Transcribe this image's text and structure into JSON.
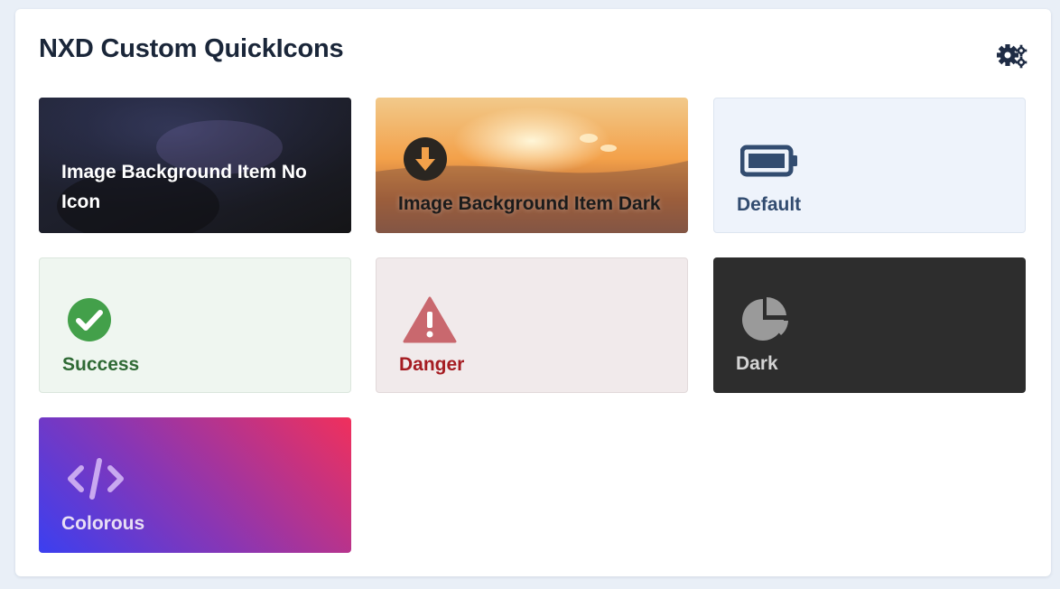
{
  "module": {
    "title": "NXD Custom QuickIcons",
    "settings_icon": "gears-icon"
  },
  "tiles": [
    {
      "label": "Image Background Item No Icon",
      "style": "image-dark",
      "icon": ""
    },
    {
      "label": "Image Background Item Dark",
      "style": "image-sunset",
      "icon": "arrow-down-circle-icon"
    },
    {
      "label": "Default",
      "style": "default",
      "icon": "battery-icon",
      "accent": "#324c70"
    },
    {
      "label": "Success",
      "style": "success",
      "icon": "check-circle-icon",
      "accent": "#43a04a"
    },
    {
      "label": "Danger",
      "style": "danger",
      "icon": "warning-triangle-icon",
      "accent": "#c9686e"
    },
    {
      "label": "Dark",
      "style": "dark",
      "icon": "pie-chart-icon",
      "accent": "#9a9a9a"
    },
    {
      "label": "Colorous",
      "style": "gradient",
      "icon": "code-icon",
      "accent": "#c9a9f0"
    }
  ],
  "colors": {
    "page_background": "#e9eff7",
    "title": "#1a2639"
  }
}
